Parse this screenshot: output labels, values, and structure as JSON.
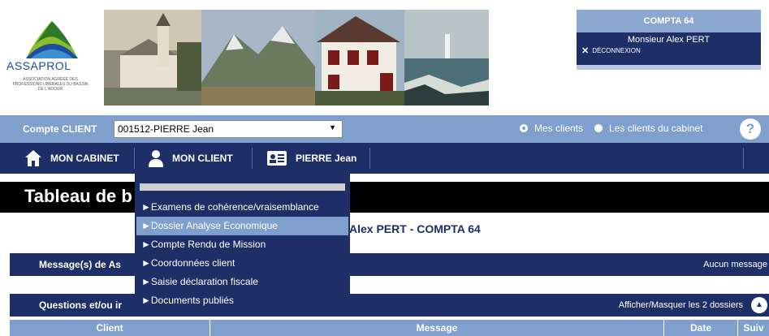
{
  "header": {
    "logo": {
      "wordmark": "ASSAPROL",
      "subtitle": "ASSOCIATION AGRÉÉE DES PROFESSIONS LIBÉRALES DU BASSIN DE L'ADOUR"
    },
    "user_panel": {
      "cabinet": "COMPTA 64",
      "user_name": "Monsieur Alex PERT",
      "logout_label": "DÉCONNEXION"
    }
  },
  "client_bar": {
    "label": "Compte CLIENT",
    "selected_client": "001512-PIERRE Jean",
    "radio_mine": "Mes clients",
    "radio_cabinet": "Les clients du cabinet",
    "help": "?"
  },
  "nav": {
    "cabinet": "MON CABINET",
    "client": "MON CLIENT",
    "client_name": "PIERRE Jean"
  },
  "dropdown": {
    "items": [
      {
        "label": "►Examens de cohérence/vraisemblance"
      },
      {
        "label": "►Dossier Analyse Economique"
      },
      {
        "label": "►Compte Rendu de Mission"
      },
      {
        "label": "►Coordonnées client"
      },
      {
        "label": "►Saisie déclaration fiscale"
      },
      {
        "label": "►Documents publiés"
      }
    ],
    "active_index": 1
  },
  "page": {
    "title_visible": "Tableau de b",
    "subtitle_visible": "Alex PERT - COMPTA 64"
  },
  "sections": {
    "messages": {
      "title_visible": "Message(s) de As",
      "right_text": "Aucun message"
    },
    "questions": {
      "title_visible": "Questions et/ou ir",
      "right_text": "Afficher/Masquer les 2 dossiers"
    }
  },
  "table": {
    "headers": [
      "Client",
      "Message",
      "Date",
      "Suiv"
    ]
  },
  "colors": {
    "navy": "#1e2f67",
    "light_blue": "#7f9fcc",
    "title_bg": "#000000"
  }
}
